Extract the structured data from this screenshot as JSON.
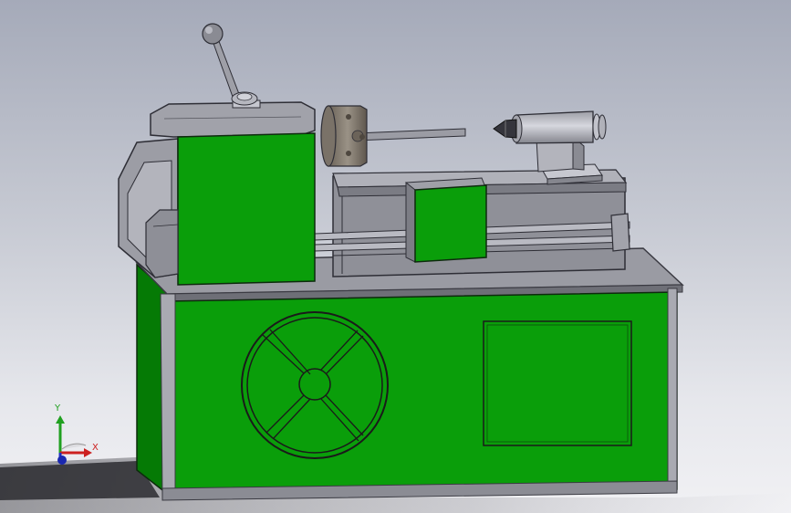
{
  "viewport": {
    "model_name": "lathe",
    "colors": {
      "accent_green": "#0a9e0a",
      "dark_green": "#057a05",
      "metal_gray": "#7e7f87",
      "light_metal": "#a5a6ae",
      "background_top": "#a5aab9",
      "background_bottom": "#f1f1f4"
    }
  },
  "triad": {
    "x_label": "X",
    "y_label": "Y",
    "x_color": "#cc2020",
    "y_color": "#20a020",
    "z_color": "#2030c0"
  }
}
